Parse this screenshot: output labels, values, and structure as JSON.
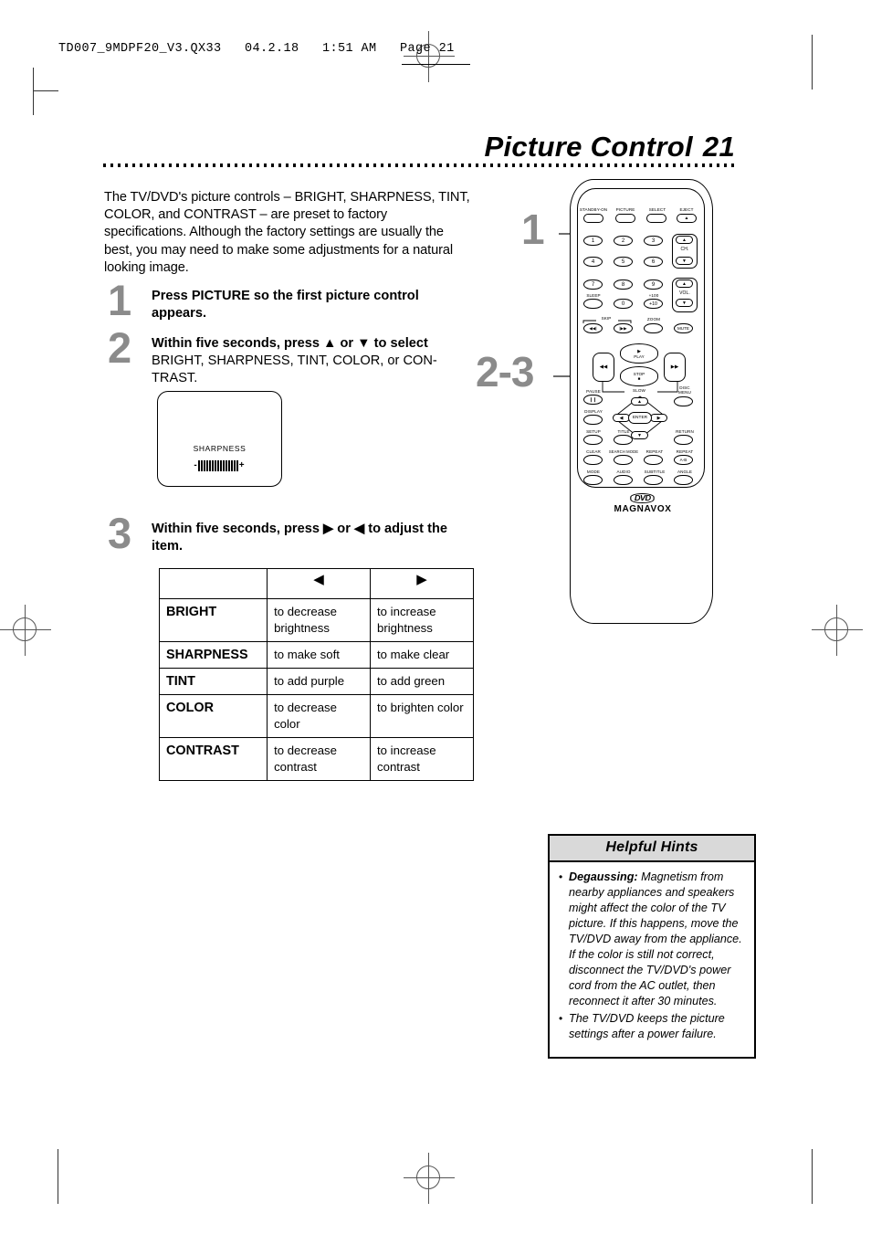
{
  "slug": {
    "text": "TD007_9MDPF20_V3.QX33   04.2.18   1:51 AM   Page 21"
  },
  "title": {
    "text": "Picture Control",
    "page_number": "21"
  },
  "intro": {
    "text": "The TV/DVD's picture controls – BRIGHT, SHARPNESS, TINT, COLOR, and CONTRAST – are preset to factory specifications.  Although the factory settings are usually the best, you may need to make some adjustments for a natural looking image."
  },
  "steps": [
    {
      "number": "1",
      "bold": "Press PICTURE so the first picture control appears.",
      "rest": ""
    },
    {
      "number": "2",
      "bold": "Within five seconds, press ▲ or ▼ to select",
      "rest": " BRIGHT, SHARPNESS, TINT, COLOR, or CON-TRAST."
    },
    {
      "number": "3",
      "bold": "Within five seconds, press ▶ or ◀ to adjust the item.",
      "rest": ""
    }
  ],
  "osd": {
    "label": "SHARPNESS",
    "minus": "-",
    "plus": "+",
    "segments": 15,
    "active_index": 7
  },
  "table": {
    "headers": [
      "",
      "◀",
      "▶"
    ],
    "rows": [
      {
        "name": "BRIGHT",
        "left": "to decrease brightness",
        "right": "to increase brightness"
      },
      {
        "name": "SHARPNESS",
        "left": "to make soft",
        "right": "to make clear"
      },
      {
        "name": "TINT",
        "left": "to add purple",
        "right": "to add green"
      },
      {
        "name": "COLOR",
        "left": "to decrease color",
        "right": "to brighten color"
      },
      {
        "name": "CONTRAST",
        "left": "to decrease contrast",
        "right": "to increase contrast"
      }
    ]
  },
  "callouts": {
    "top": "1",
    "mid": "2-3"
  },
  "remote": {
    "brand": "MAGNAVOX",
    "disc_logo": "DVD",
    "row_top": [
      "STANDBY-ON",
      "PICTURE",
      "SELECT",
      "EJECT"
    ],
    "eject_glyph": "▲",
    "keys": [
      "1",
      "2",
      "3",
      "4",
      "5",
      "6",
      "7",
      "8",
      "9",
      "0"
    ],
    "plus100": "+100",
    "plus10": "+10",
    "sleep": "SLEEP",
    "ch": "CH.",
    "vol": "VOL.",
    "up_glyph": "▲",
    "down_glyph": "▼",
    "skip": "SKIP",
    "skip_back": "◀◀|",
    "skip_fwd": "|▶▶",
    "zoom": "ZOOM",
    "mute": "MUTE",
    "play": "PLAY",
    "play_glyph": "▶",
    "stop": "STOP",
    "stop_glyph": "■",
    "rew_glyph": "◀◀",
    "ff_glyph": "▶▶",
    "slow": "SLOW",
    "pause": "PAUSE",
    "pause_glyph": "❙❙",
    "display": "DISPLAY",
    "disc_menu_l1": "DISC",
    "disc_menu_l2": "MENU",
    "enter": "ENTER",
    "left_glyph": "◀",
    "right_glyph": "▶",
    "setup": "SETUP",
    "title": "TITLE",
    "return": "RETURN",
    "clear": "CLEAR",
    "search_mode": "SEARCH MODE",
    "repeat": "REPEAT",
    "repeat_ab_label": "REPEAT",
    "repeat_ab": "A-B",
    "mode": "MODE",
    "audio": "AUDIO",
    "subtitle": "SUBTITLE",
    "angle": "ANGLE"
  },
  "hints": {
    "title": "Helpful Hints",
    "items": [
      {
        "bullet": "•",
        "lead": "Degaussing:",
        "text": " Magnetism from nearby appliances and speakers might affect the color of the TV picture. If this happens, move the TV/DVD away from the appliance.  If the color is still not correct, disconnect the TV/DVD's power cord from the AC outlet, then reconnect it after 30 minutes."
      },
      {
        "bullet": "•",
        "lead": "",
        "text": "The TV/DVD keeps the picture settings after a power failure."
      }
    ]
  }
}
